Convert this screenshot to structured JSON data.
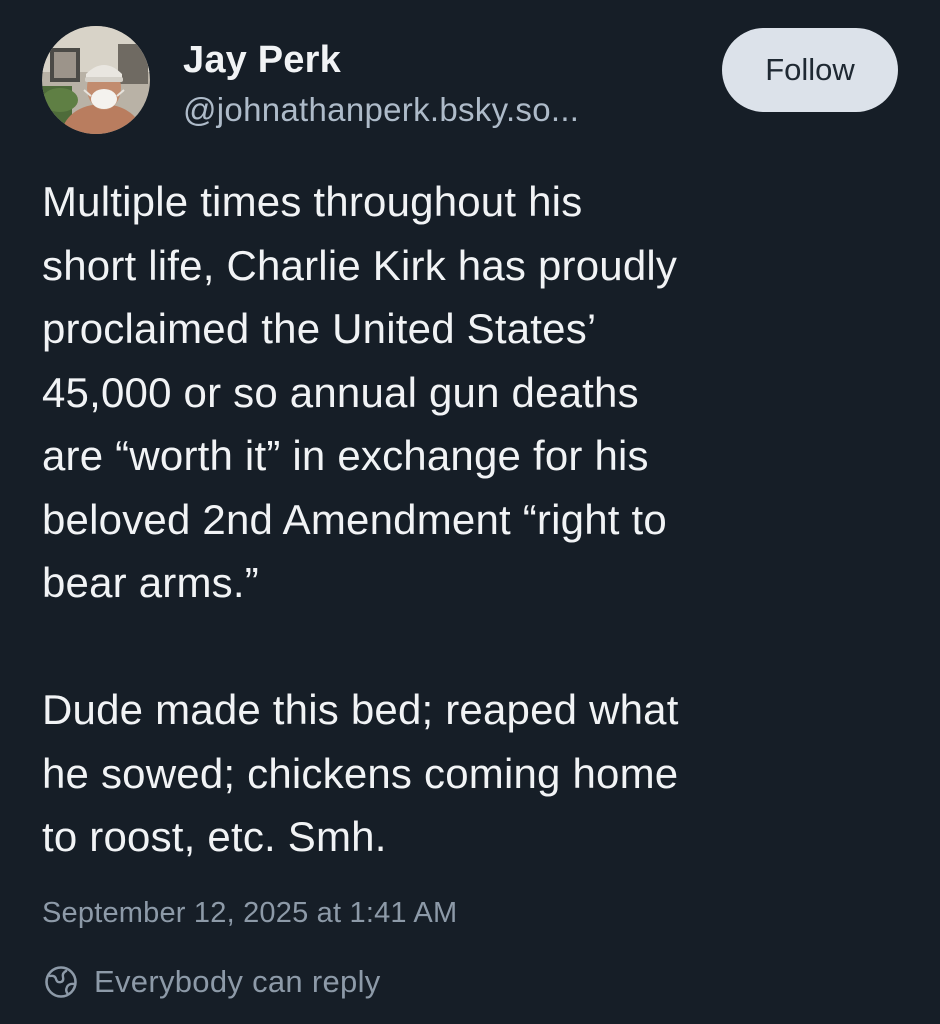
{
  "author": {
    "display_name": "Jay Perk",
    "handle": "@johnathanperk.bsky.so..."
  },
  "follow_label": "Follow",
  "post": {
    "text": "Multiple times throughout his\nshort life, Charlie Kirk has proudly\nproclaimed the United States’\n45,000 or so annual gun deaths\nare “worth it” in exchange for his\nbeloved 2nd Amendment “right to\nbear arms.”\n\nDude made this bed; reaped what\nhe sowed; chickens coming home\nto roost, etc. Smh.",
    "timestamp": "September 12, 2025 at 1:41 AM",
    "reply_setting": "Everybody can reply"
  },
  "icons": {
    "reply_setting": "globe-icon"
  },
  "colors": {
    "background": "#161e27",
    "text": "#f1f3f5",
    "muted": "#8d9aa8",
    "handle": "#aebbc9",
    "follow_bg": "#dce2ea"
  }
}
